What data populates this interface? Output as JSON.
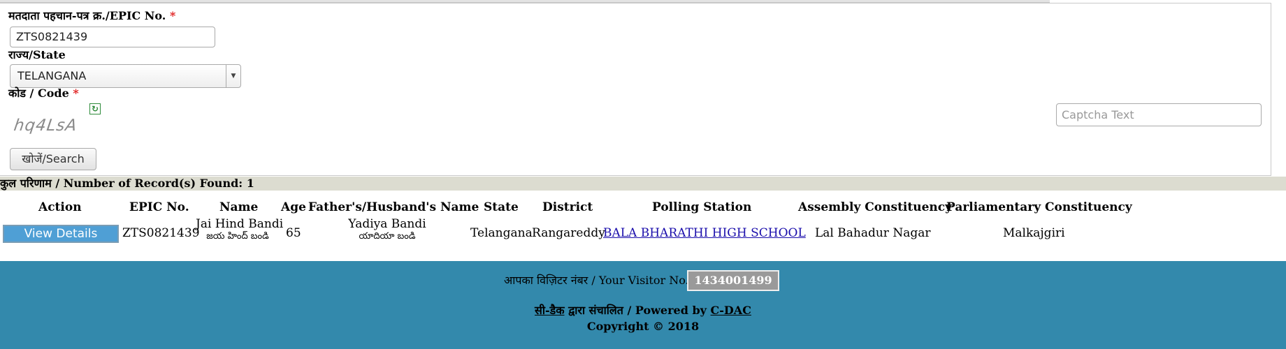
{
  "form": {
    "epic_label": "मतदाता पहचान-पत्र क्र./EPIC No.",
    "required_mark": "*",
    "epic_value": "ZTS0821439",
    "state_label": "राज्य/State",
    "state_value": "TELANGANA",
    "code_label": "कोड / Code",
    "captcha_image_text": "hq4LsA",
    "refresh_icon": "refresh-icon",
    "captcha_placeholder": "Captcha Text",
    "search_label": "खोजें/Search"
  },
  "records": {
    "summary": "कुल परिणाम / Number of Record(s) Found: 1"
  },
  "table": {
    "headers": {
      "action": "Action",
      "epic": "EPIC No.",
      "name": "Name",
      "age": "Age",
      "relative": "Father's/Husband's Name",
      "state": "State",
      "district": "District",
      "polling": "Polling Station",
      "assembly": "Assembly Constituency",
      "parliamentary": "Parliamentary Constituency"
    },
    "rows": [
      {
        "action": "View Details",
        "epic": "ZTS0821439",
        "name": "Jai Hind Bandi",
        "name_local": "జయ హింద్ బండి",
        "age": "65",
        "relative": "Yadiya Bandi",
        "relative_local": "యాదియా బండి",
        "state": "Telangana",
        "district": "Rangareddy",
        "polling": "BALA BHARATHI HIGH SCHOOL",
        "assembly": "Lal Bahadur Nagar",
        "parliamentary": "Malkajgiri"
      }
    ]
  },
  "footer": {
    "visitor_label": "आपका विज़िटर नंबर / Your Visitor No.",
    "visitor_count": "1434001499",
    "cdac_hindi": "सी-डैक",
    "powered_mid": " द्वारा संचालित / Powered by ",
    "cdac": "C-DAC",
    "copyright": "Copyright © 2018",
    "background_color": "#3389ac"
  }
}
